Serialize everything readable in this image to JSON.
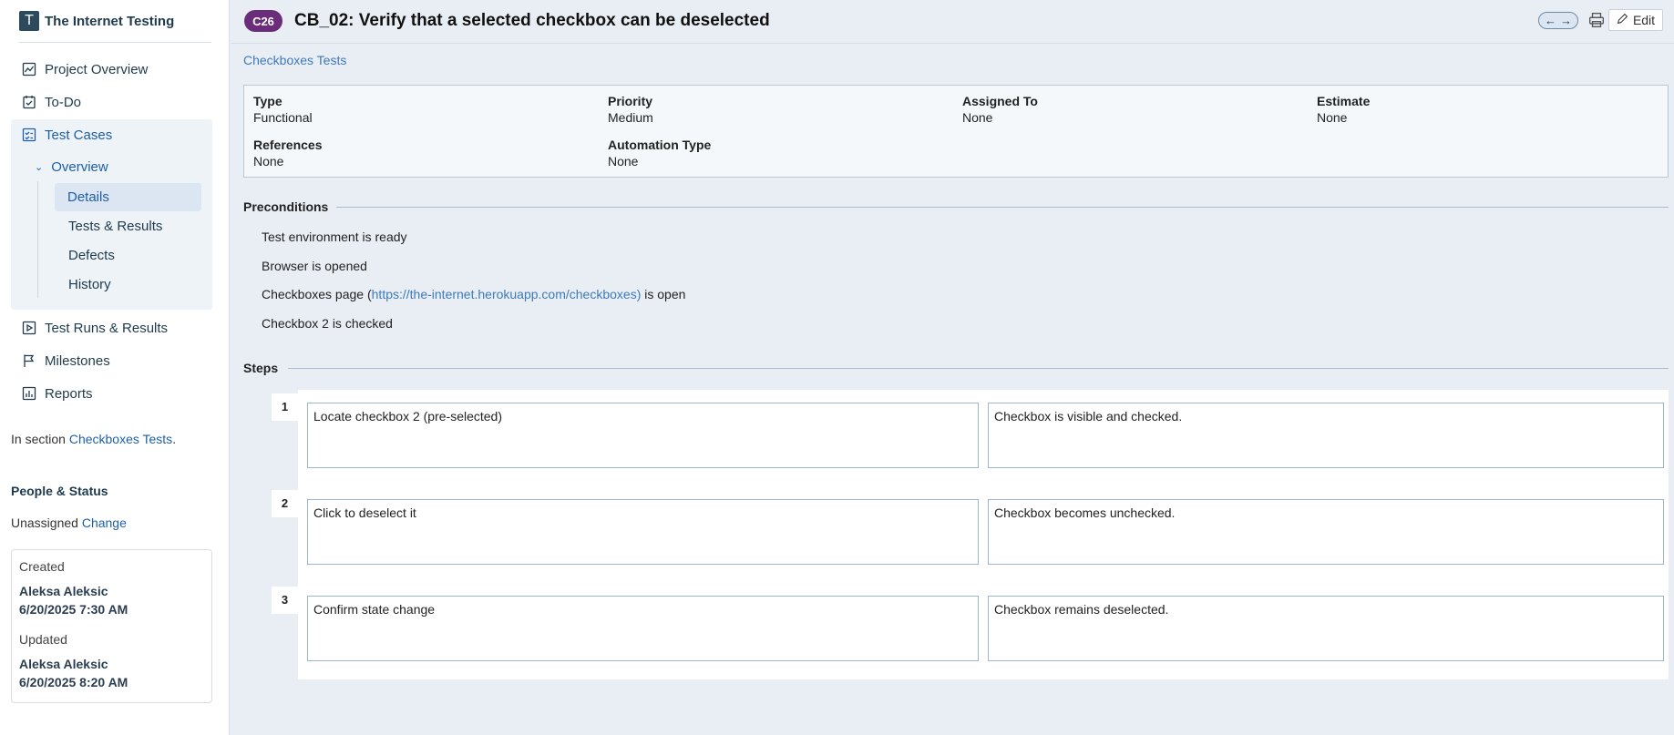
{
  "brand": {
    "logo_letter": "T",
    "name": "The Internet Testing"
  },
  "nav": {
    "project_overview": "Project Overview",
    "todo": "To-Do",
    "test_cases": "Test Cases",
    "overview": "Overview",
    "details": "Details",
    "tests_results": "Tests & Results",
    "defects": "Defects",
    "history": "History",
    "test_runs": "Test Runs & Results",
    "milestones": "Milestones",
    "reports": "Reports"
  },
  "section_info": {
    "prefix": "In section ",
    "link": "Checkboxes Tests",
    "suffix": "."
  },
  "people": {
    "title": "People & Status",
    "assignee": "Unassigned",
    "change": "Change",
    "created_label": "Created",
    "created_by": "Aleksa Aleksic",
    "created_at": "6/20/2025 7:30 AM",
    "updated_label": "Updated",
    "updated_by": "Aleksa Aleksic",
    "updated_at": "6/20/2025 8:20 AM"
  },
  "header": {
    "case_id": "C26",
    "title": "CB_02: Verify that a selected checkbox can be deselected",
    "prev_arrow": "←",
    "next_arrow": "→",
    "edit_label": "Edit"
  },
  "breadcrumb_section": "Checkboxes Tests",
  "fields": {
    "type_label": "Type",
    "type_value": "Functional",
    "priority_label": "Priority",
    "priority_value": "Medium",
    "assigned_label": "Assigned To",
    "assigned_value": "None",
    "estimate_label": "Estimate",
    "estimate_value": "None",
    "references_label": "References",
    "references_value": "None",
    "automation_label": "Automation Type",
    "automation_value": "None"
  },
  "preconditions": {
    "title": "Preconditions",
    "line1": "Test environment is ready",
    "line2": "Browser is opened",
    "line3_prefix": "Checkboxes page (",
    "line3_link": "https://the-internet.herokuapp.com/checkboxes)",
    "line3_suffix": " is open",
    "line4": "Checkbox 2 is checked"
  },
  "steps": {
    "title": "Steps",
    "items": [
      {
        "num": "1",
        "action": "Locate checkbox 2 (pre-selected)",
        "expected": "Checkbox is visible and checked."
      },
      {
        "num": "2",
        "action": "Click to deselect it",
        "expected": "Checkbox becomes unchecked."
      },
      {
        "num": "3",
        "action": "Confirm state change",
        "expected": "Checkbox remains deselected."
      }
    ]
  }
}
